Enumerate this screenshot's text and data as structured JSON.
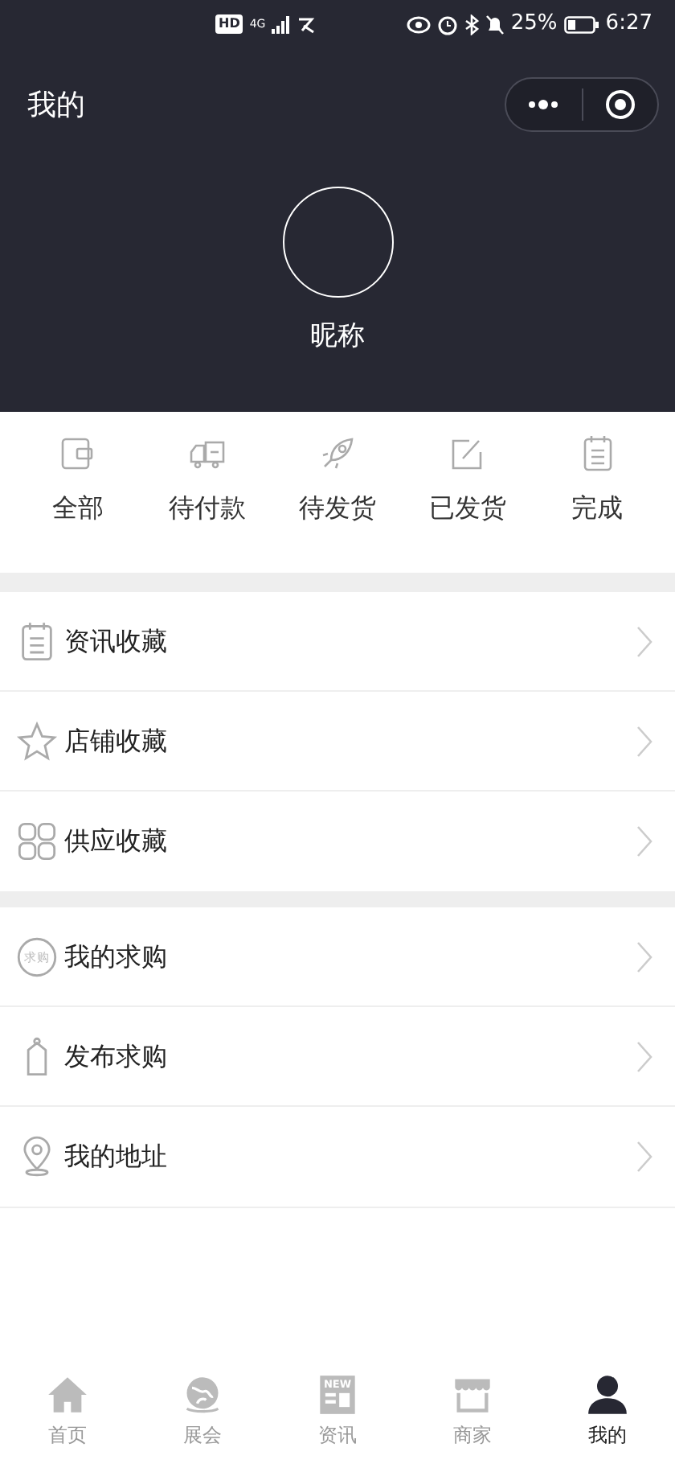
{
  "status_bar": {
    "hd": "HD",
    "network": "4G",
    "battery": "25%",
    "time": "6:27"
  },
  "header": {
    "title": "我的"
  },
  "profile": {
    "nickname": "昵称"
  },
  "orders": [
    {
      "kind": "wallet",
      "label": "全部"
    },
    {
      "kind": "truck",
      "label": "待付款"
    },
    {
      "kind": "rocket",
      "label": "待发货"
    },
    {
      "kind": "edit",
      "label": "已发货"
    },
    {
      "kind": "clipboard",
      "label": "完成"
    }
  ],
  "menu_groups": [
    [
      {
        "kind": "clipboard",
        "label": "资讯收藏"
      },
      {
        "kind": "star",
        "label": "店铺收藏"
      },
      {
        "kind": "grid",
        "label": "供应收藏"
      }
    ],
    [
      {
        "kind": "badge",
        "icon_text": "求购",
        "label": "我的求购"
      },
      {
        "kind": "tag",
        "label": "发布求购"
      },
      {
        "kind": "pin",
        "label": "我的地址"
      }
    ]
  ],
  "tab_bar": [
    {
      "kind": "home",
      "label": "首页",
      "selected": false
    },
    {
      "kind": "globe",
      "label": "展会",
      "selected": false
    },
    {
      "kind": "news",
      "icon_text": "NEW",
      "label": "资讯",
      "selected": false
    },
    {
      "kind": "shop",
      "label": "商家",
      "selected": false
    },
    {
      "kind": "person",
      "label": "我的",
      "selected": true
    }
  ]
}
